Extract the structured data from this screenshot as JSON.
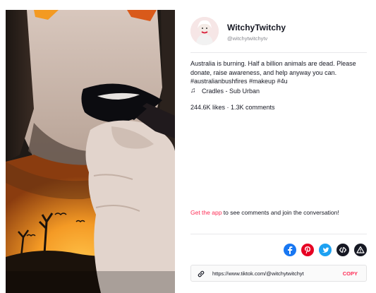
{
  "author": {
    "display_name": "WitchyTwitchy",
    "username": "@witchytwitchytv"
  },
  "post": {
    "description": "Australia is burning. Half a billion animals are dead. Please donate, raise awareness, and help anyway you can. #australianbushfires #makeup #4u",
    "music": "Cradles - Sub Urban",
    "stats": "244.6K likes · 1.3K comments"
  },
  "cta": {
    "link_text": "Get the app",
    "rest_text": " to see comments and join the conversation!"
  },
  "share": {
    "icons": [
      "facebook-icon",
      "pinterest-icon",
      "twitter-icon",
      "embed-icon",
      "report-icon"
    ],
    "colors": {
      "facebook": "#1877f2",
      "pinterest": "#e60023",
      "twitter": "#1da1f2",
      "embed": "#161823",
      "report": "#161823"
    }
  },
  "copy_link": {
    "url": "https://www.tiktok.com/@witchytwitchyt",
    "button": "COPY"
  },
  "colors": {
    "accent": "#fe2c55",
    "text": "#161823",
    "muted": "#8a8b91"
  }
}
